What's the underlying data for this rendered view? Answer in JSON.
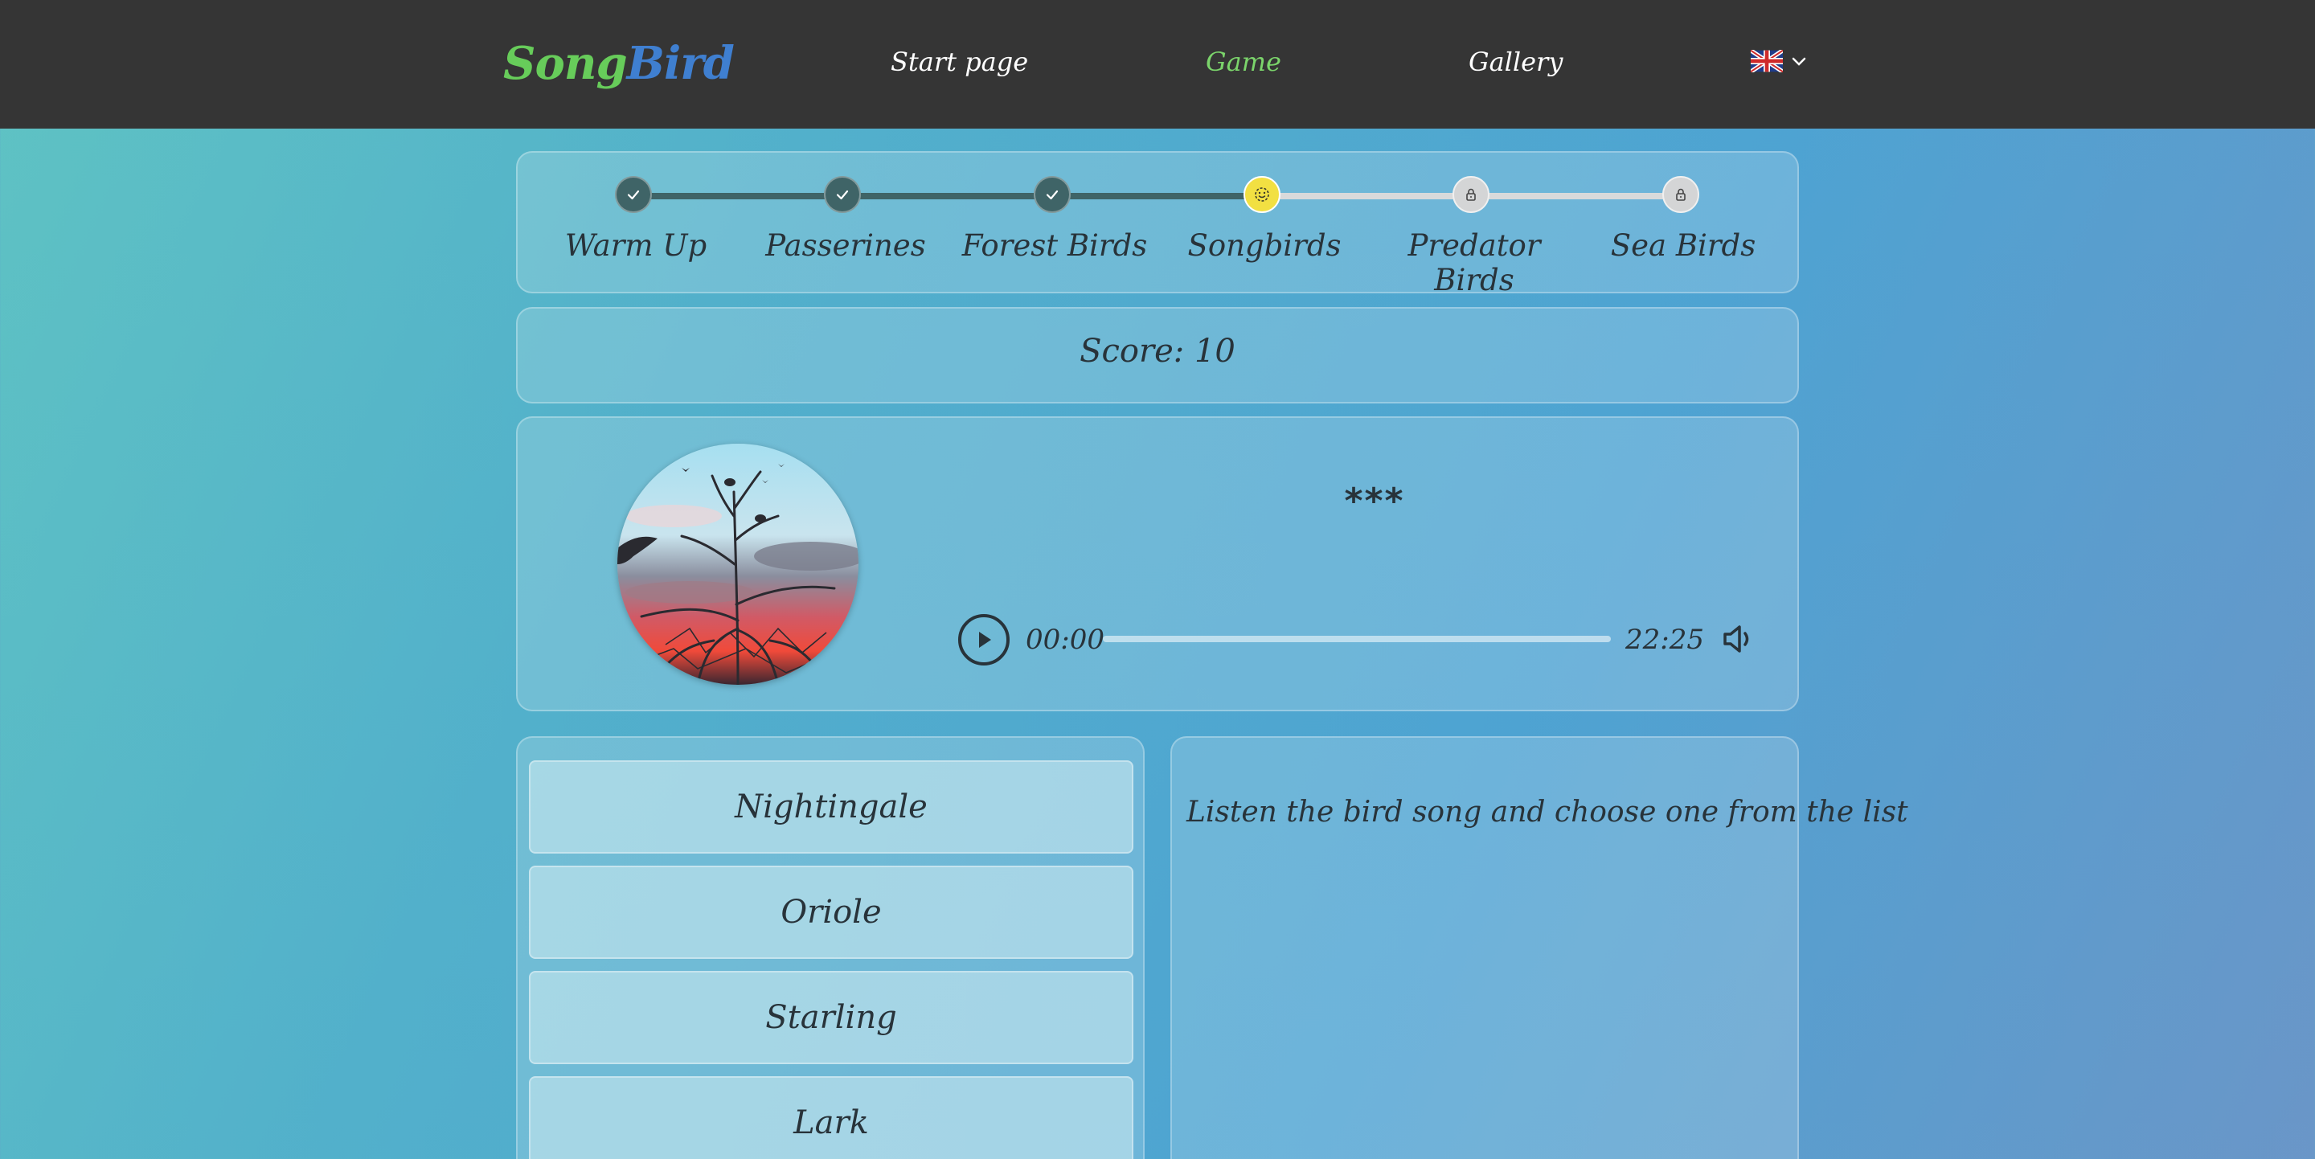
{
  "header": {
    "logo_part1": "Song",
    "logo_part2": "Bird",
    "nav": [
      {
        "label": "Start page",
        "active": false
      },
      {
        "label": "Game",
        "active": true
      },
      {
        "label": "Gallery",
        "active": false
      }
    ],
    "language_icon": "uk-flag-icon"
  },
  "levels": [
    {
      "label": "Warm Up",
      "state": "done"
    },
    {
      "label": "Passerines",
      "state": "done"
    },
    {
      "label": "Forest Birds",
      "state": "done"
    },
    {
      "label": "Songbirds",
      "state": "current"
    },
    {
      "label": "Predator Birds",
      "state": "locked"
    },
    {
      "label": "Sea Birds",
      "state": "locked"
    }
  ],
  "score": {
    "text": "Score: 10"
  },
  "player": {
    "bird_name": "***",
    "current_time": "00:00",
    "duration": "22:25",
    "progress": 0
  },
  "answers": [
    "Nightingale",
    "Oriole",
    "Starling",
    "Lark"
  ],
  "info": {
    "hint": "Listen the bird song and choose one from the list"
  },
  "colors": {
    "header_bg": "#353535",
    "logo_green": "#67cc5a",
    "logo_blue": "#3f7fd0",
    "nav_active": "#7bd46b",
    "step_done": "#3f6467",
    "step_current": "#f2e042",
    "step_locked": "#d4d5d6",
    "text_dark": "#28333a"
  }
}
